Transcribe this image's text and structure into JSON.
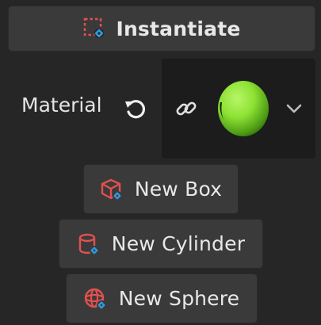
{
  "instantiate": {
    "label": "Instantiate",
    "icon": "instantiate-icon"
  },
  "material": {
    "label": "Material",
    "reset_icon": "reset-icon",
    "link_icon": "link-icon",
    "thumbnail": "material-sphere-thumbnail",
    "thumbnail_color": "#8ee233",
    "dropdown_icon": "chevron-down-icon"
  },
  "buttons": [
    {
      "label": "New Box",
      "icon": "box-icon"
    },
    {
      "label": "New Cylinder",
      "icon": "cylinder-icon"
    },
    {
      "label": "New Sphere",
      "icon": "sphere-icon"
    }
  ],
  "colors": {
    "background": "#262626",
    "button": "#3a3a3a",
    "icon_red": "#e2504f",
    "icon_blue": "#2f9be0",
    "text": "#e8e8e8"
  }
}
